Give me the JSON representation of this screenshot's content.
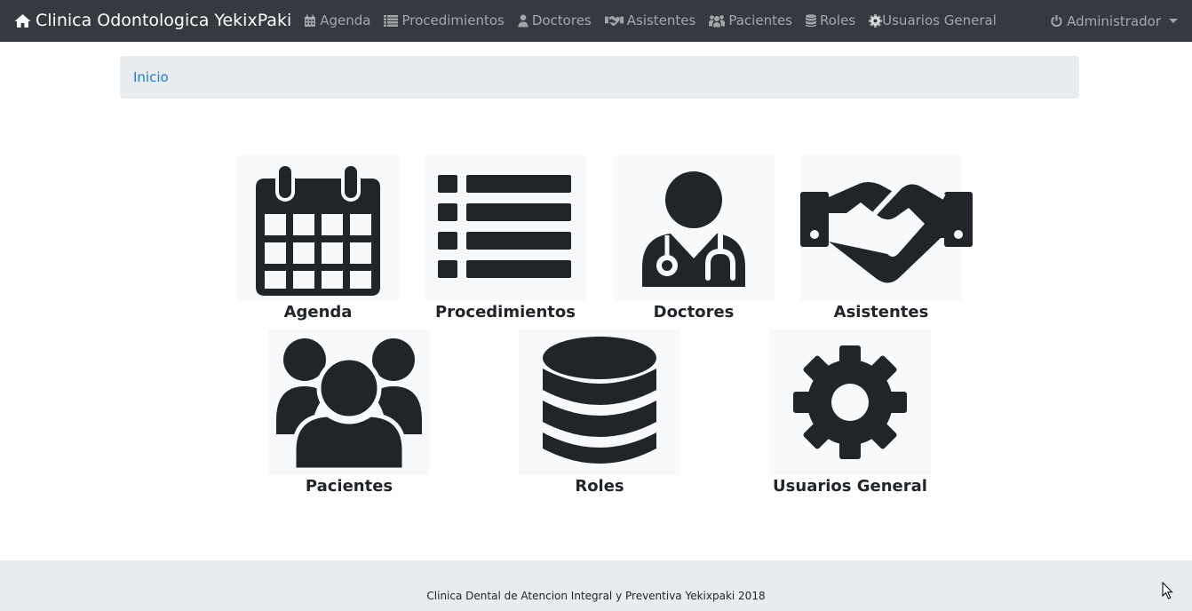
{
  "navbar": {
    "brand": "Clinica Odontologica YekixPaki",
    "items": [
      {
        "label": "Agenda",
        "icon": "calendar-icon"
      },
      {
        "label": "Procedimientos",
        "icon": "list-icon"
      },
      {
        "label": "Doctores",
        "icon": "user-md-icon"
      },
      {
        "label": "Asistentes",
        "icon": "handshake-icon"
      },
      {
        "label": "Pacientes",
        "icon": "users-icon"
      },
      {
        "label": "Roles",
        "icon": "database-icon"
      },
      {
        "label": "Usuarios General",
        "icon": "cog-icon"
      }
    ],
    "user_menu": "Administrador"
  },
  "breadcrumb": {
    "home": "Inicio"
  },
  "tiles": [
    {
      "label": "Agenda",
      "icon": "calendar-icon"
    },
    {
      "label": "Procedimientos",
      "icon": "list-icon"
    },
    {
      "label": "Doctores",
      "icon": "user-md-icon"
    },
    {
      "label": "Asistentes",
      "icon": "handshake-icon"
    },
    {
      "label": "Pacientes",
      "icon": "users-icon"
    },
    {
      "label": "Roles",
      "icon": "database-icon"
    },
    {
      "label": "Usuarios General",
      "icon": "cog-icon"
    }
  ],
  "footer": {
    "text": "Clinica Dental de Atencion Integral y Preventiva Yekixpaki 2018"
  },
  "colors": {
    "navbar": "#343a40",
    "link": "#1f7ad6",
    "breadcrumb_bg": "#e9ecef",
    "tile_bg": "#f8f9fa"
  }
}
